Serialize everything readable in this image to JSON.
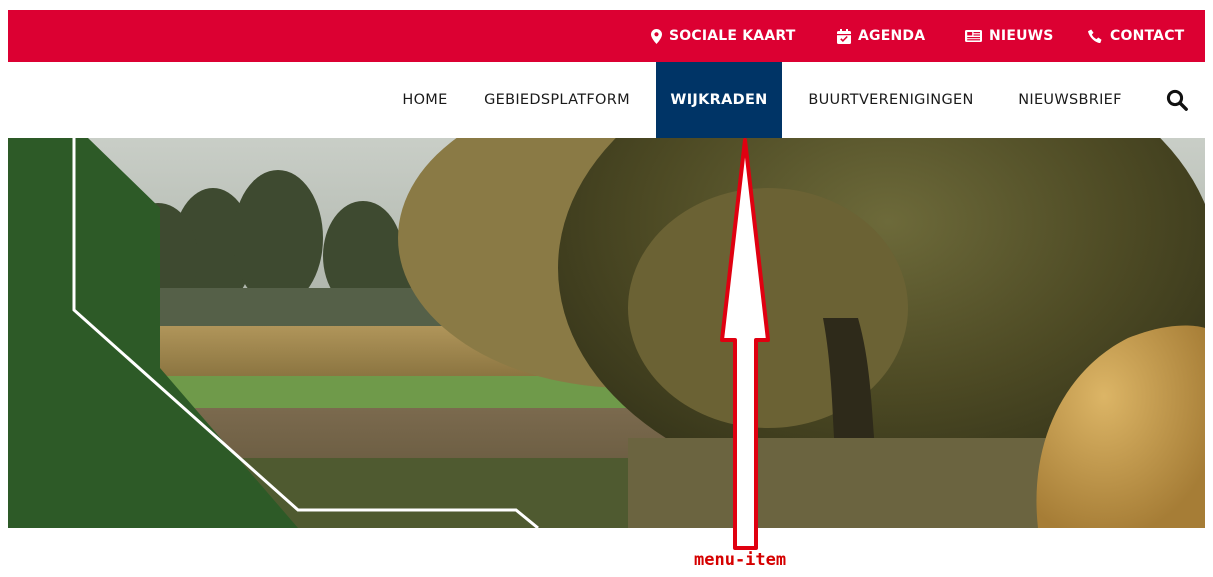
{
  "topbar": {
    "links": [
      {
        "label": "SOCIALE KAART",
        "icon": "map-marker-icon"
      },
      {
        "label": "AGENDA",
        "icon": "calendar-check-icon"
      },
      {
        "label": "NIEUWS",
        "icon": "newspaper-icon"
      },
      {
        "label": "CONTACT",
        "icon": "phone-icon"
      }
    ],
    "color": "#dc0032"
  },
  "mainnav": {
    "items": [
      {
        "label": "HOME",
        "active": false
      },
      {
        "label": "GEBIEDSPLATFORM",
        "active": false
      },
      {
        "label": "WIJKRADEN",
        "active": true
      },
      {
        "label": "BUURTVERENIGINGEN",
        "active": false
      },
      {
        "label": "NIEUWSBRIEF",
        "active": false
      }
    ],
    "active_color": "#003466",
    "search_icon": "search-icon"
  },
  "hero": {
    "image": "rural-landscape-with-trees-cornfield",
    "accent_color": "#2d5a27"
  },
  "annotation": {
    "label": "menu-item",
    "color": "#d50000",
    "arrow_icon": "up-arrow-icon"
  }
}
